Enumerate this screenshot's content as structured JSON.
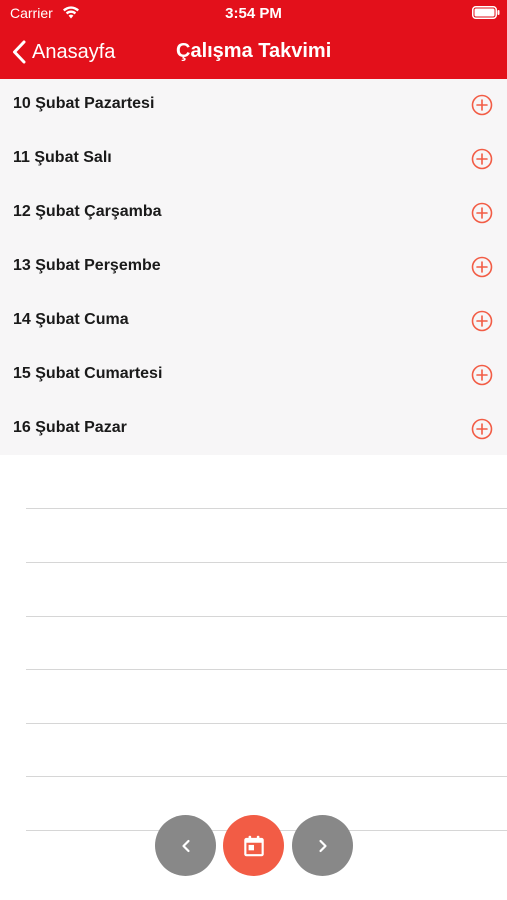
{
  "status_bar": {
    "carrier": "Carrier",
    "time": "3:54 PM",
    "icons": [
      "wifi-icon",
      "battery-icon"
    ]
  },
  "nav": {
    "back_label": "Anasayfa",
    "title": "Çalışma Takvimi",
    "back_icon": "chevron-left-icon"
  },
  "days": [
    {
      "label": "10 Şubat Pazartesi"
    },
    {
      "label": "11 Şubat Salı"
    },
    {
      "label": "12 Şubat Çarşamba"
    },
    {
      "label": "13 Şubat Perşembe"
    },
    {
      "label": "14 Şubat Cuma"
    },
    {
      "label": "15 Şubat Cumartesi"
    },
    {
      "label": "16 Şubat Pazar"
    }
  ],
  "row_icon": "plus-circle-icon",
  "bottom_controls": [
    {
      "name": "previous-week-button",
      "icon": "chevron-left-icon"
    },
    {
      "name": "calendar-button",
      "icon": "calendar-icon"
    },
    {
      "name": "next-week-button",
      "icon": "chevron-right-icon"
    }
  ],
  "colors": {
    "header_background": "#e3101b",
    "accent": "#f25c45",
    "list_background": "#f7f6f7",
    "nav_button_gray": "#888888"
  }
}
